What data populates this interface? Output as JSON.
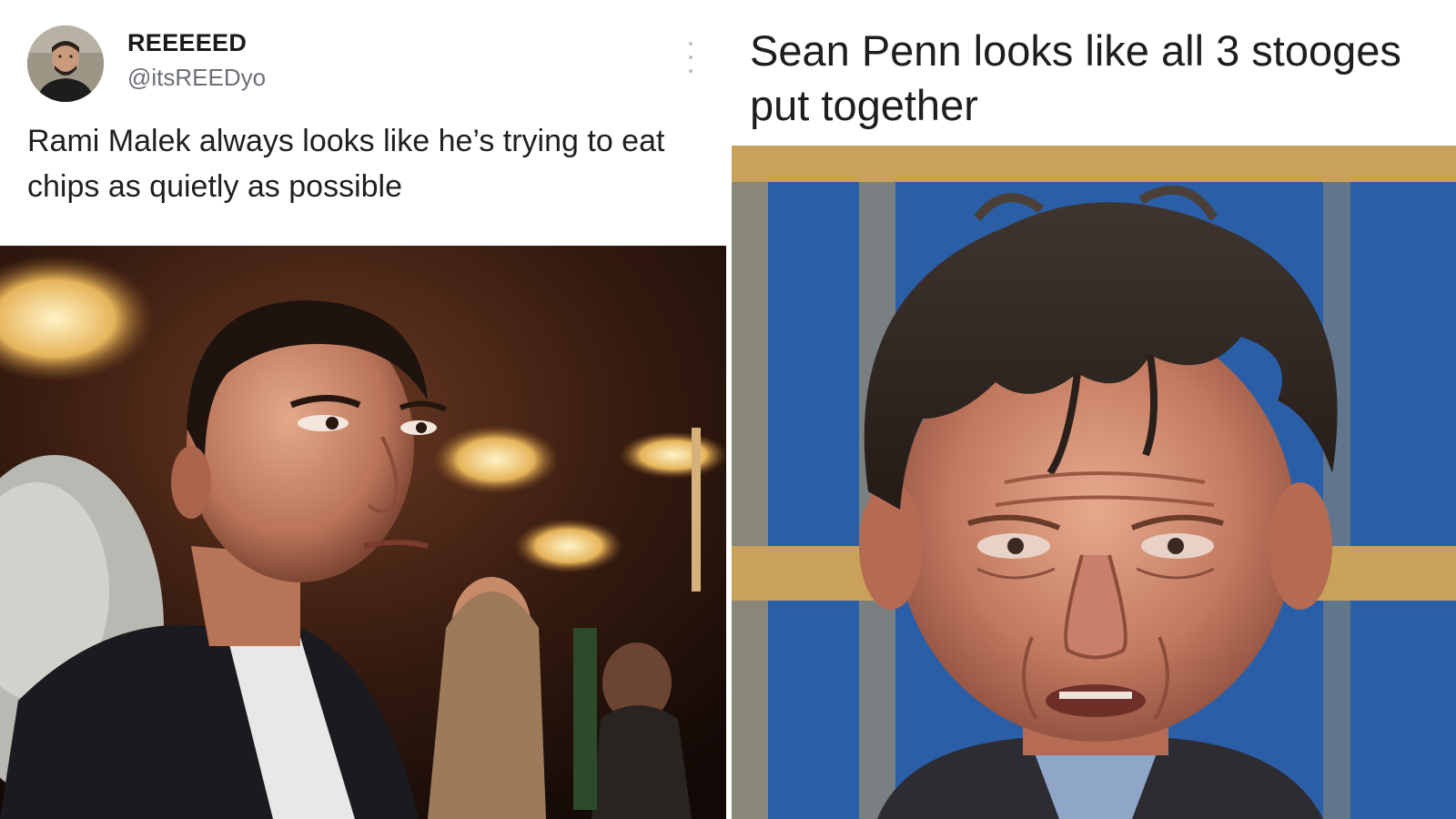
{
  "left": {
    "tweet": {
      "display_name": "REEEEED",
      "handle": "@itsREEDyo",
      "text": "Rami Malek always looks like he’s trying to eat chips as quietly as possible"
    },
    "avatar_icon": "user-avatar",
    "more_icon": "more-vertical-icon",
    "photo_description_icon": "photo"
  },
  "right": {
    "caption": "Sean Penn looks like all 3 stooges put together"
  },
  "colors": {
    "name": "#1a1a1a",
    "handle": "#6b7077",
    "text": "#1d1f22",
    "right_background_blue": "#2a5fa8",
    "right_background_gold": "#c9a15a"
  }
}
